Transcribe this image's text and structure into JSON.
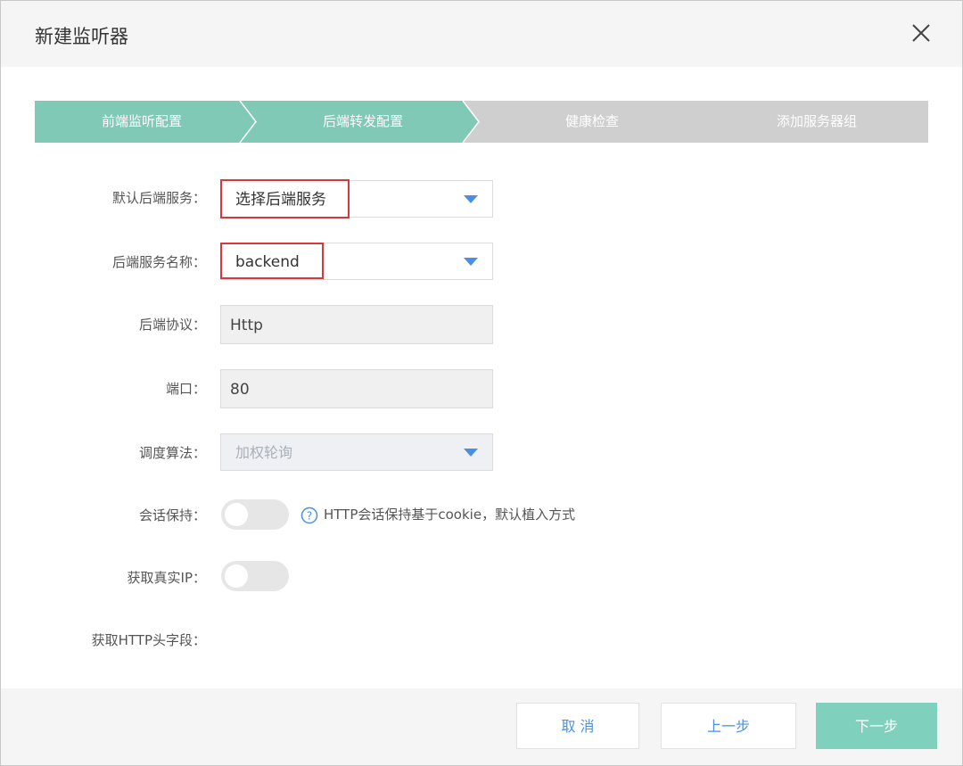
{
  "dialog": {
    "title": "新建监听器",
    "close_icon": "close-icon"
  },
  "steps": [
    {
      "label": "前端监听配置",
      "state": "done"
    },
    {
      "label": "后端转发配置",
      "state": "active"
    },
    {
      "label": "健康检查",
      "state": "pending"
    },
    {
      "label": "添加服务器组",
      "state": "pending"
    }
  ],
  "form": {
    "default_backend": {
      "label": "默认后端服务：",
      "value": "选择后端服务"
    },
    "backend_name": {
      "label": "后端服务名称：",
      "value": "backend"
    },
    "protocol": {
      "label": "后端协议：",
      "value": "Http"
    },
    "port": {
      "label": "端口：",
      "value": "80"
    },
    "algorithm": {
      "label": "调度算法：",
      "value": "加权轮询"
    },
    "session": {
      "label": "会话保持：",
      "hint": "HTTP会话保持基于cookie，默认植入方式",
      "enabled": false
    },
    "real_ip": {
      "label": "获取真实IP：",
      "enabled": false
    },
    "http_header": {
      "label": "获取HTTP头字段："
    }
  },
  "footer": {
    "cancel": "取 消",
    "prev": "上一步",
    "next": "下一步"
  },
  "colors": {
    "accent_teal": "#7fd0bd",
    "step_done": "#7fc9b6",
    "step_pending": "#cfcfcf",
    "link_blue": "#4a90e2",
    "highlight_red": "#d9383a"
  }
}
